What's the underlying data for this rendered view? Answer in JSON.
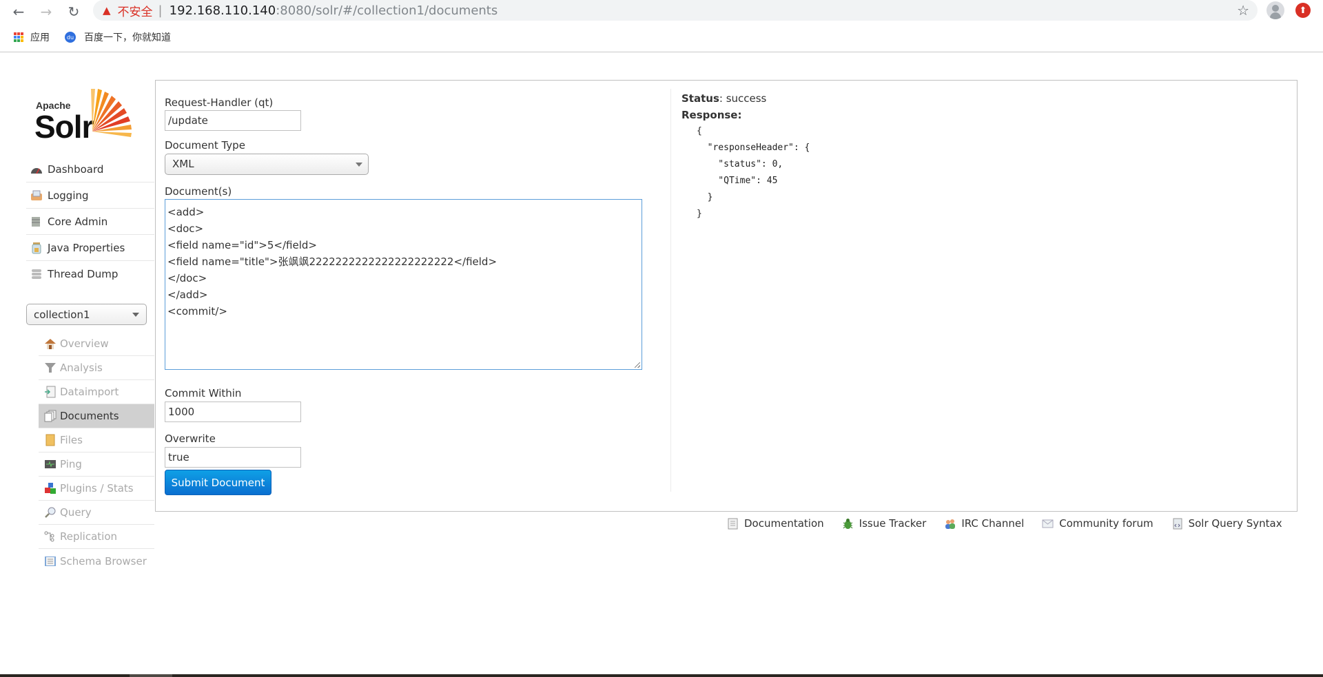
{
  "browser": {
    "security_label": "不安全",
    "url_host": "192.168.110.140",
    "url_path": ":8080/solr/#/collection1/documents",
    "bookmarks": [
      {
        "label": "应用",
        "icon": "apps-grid-icon"
      },
      {
        "label": "百度一下，你就知道",
        "icon": "baidu-paw-icon"
      }
    ]
  },
  "logo": {
    "apache": "Apache",
    "solr": "Solr"
  },
  "sidebar": {
    "items": [
      {
        "label": "Dashboard",
        "icon": "dashboard-gauge-icon"
      },
      {
        "label": "Logging",
        "icon": "logging-tray-icon"
      },
      {
        "label": "Core Admin",
        "icon": "core-admin-icon"
      },
      {
        "label": "Java Properties",
        "icon": "java-jar-icon"
      },
      {
        "label": "Thread Dump",
        "icon": "thread-dump-icon"
      }
    ],
    "core_selector": "collection1",
    "core_items": [
      {
        "label": "Overview",
        "icon": "house-icon",
        "active": false
      },
      {
        "label": "Analysis",
        "icon": "funnel-icon",
        "active": false
      },
      {
        "label": "Dataimport",
        "icon": "dataimport-icon",
        "active": false
      },
      {
        "label": "Documents",
        "icon": "documents-icon",
        "active": true
      },
      {
        "label": "Files",
        "icon": "folder-icon",
        "active": false
      },
      {
        "label": "Ping",
        "icon": "ping-monitor-icon",
        "active": false
      },
      {
        "label": "Plugins / Stats",
        "icon": "plugins-blocks-icon",
        "active": false
      },
      {
        "label": "Query",
        "icon": "magnifier-icon",
        "active": false
      },
      {
        "label": "Replication",
        "icon": "replication-icon",
        "active": false
      },
      {
        "label": "Schema Browser",
        "icon": "book-icon",
        "active": false
      }
    ]
  },
  "form": {
    "request_handler_label": "Request-Handler (qt)",
    "request_handler_value": "/update",
    "document_type_label": "Document Type",
    "document_type_value": "XML",
    "documents_label": "Document(s)",
    "documents_value": "<add>\n<doc>\n<field name=\"id\">5</field>\n<field name=\"title\">张飒飒2222222222222222222222</field>\n</doc>\n</add>\n<commit/>",
    "commit_within_label": "Commit Within",
    "commit_within_value": "1000",
    "overwrite_label": "Overwrite",
    "overwrite_value": "true",
    "submit_label": "Submit Document"
  },
  "response": {
    "status_label": "Status",
    "status_value": ": success",
    "response_label": "Response:",
    "json_text": "{\n  \"responseHeader\": {\n    \"status\": 0,\n    \"QTime\": 45\n  }\n}"
  },
  "footer": {
    "links": [
      {
        "label": "Documentation",
        "icon": "document-icon"
      },
      {
        "label": "Issue Tracker",
        "icon": "bug-icon"
      },
      {
        "label": "IRC Channel",
        "icon": "people-icon"
      },
      {
        "label": "Community forum",
        "icon": "envelope-icon"
      },
      {
        "label": "Solr Query Syntax",
        "icon": "scroll-icon"
      }
    ]
  },
  "colors": {
    "accent_blue": "#0a6fd0",
    "active_menu_bg": "#d0d0d0",
    "warning_red": "#d93025",
    "focus_border": "#5b9dd9"
  }
}
